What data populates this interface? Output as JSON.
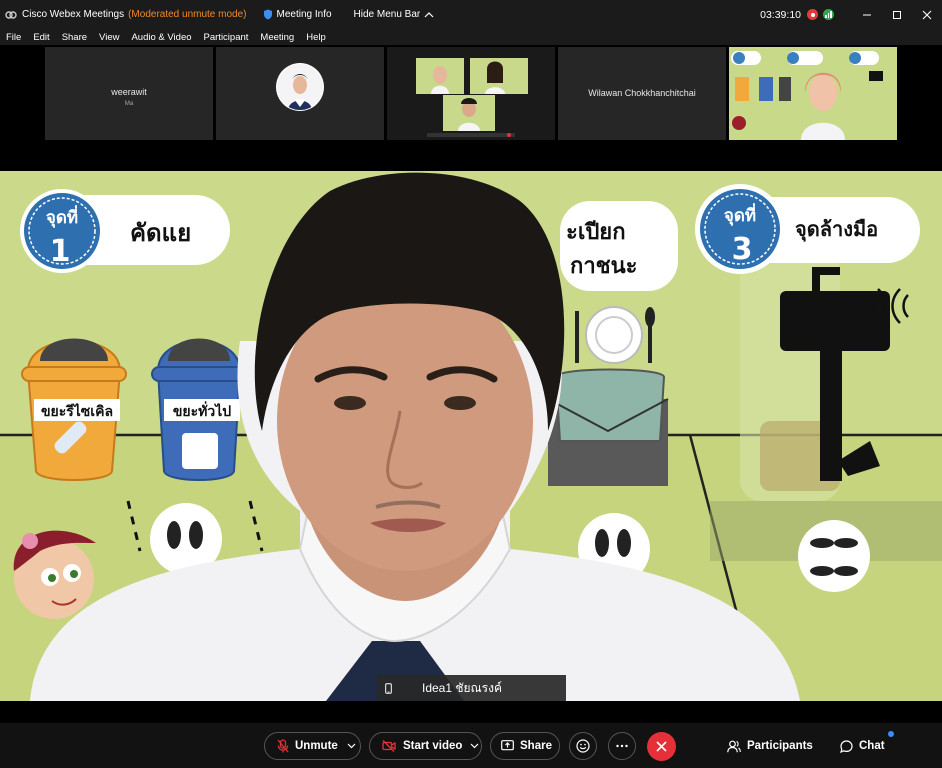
{
  "window": {
    "title": "Cisco Webex Meetings",
    "mode": "(Moderated unmute mode)",
    "meeting_info": "Meeting Info",
    "hide_menu_bar": "Hide Menu Bar",
    "time": "03:39:10"
  },
  "menu": [
    "File",
    "Edit",
    "Share",
    "View",
    "Audio & Video",
    "Participant",
    "Meeting",
    "Help"
  ],
  "thumbnails": [
    {
      "name": "weerawit",
      "sub": "Ma"
    },
    {
      "name": ""
    },
    {
      "name": ""
    },
    {
      "name": "Wilawan Chokkhanchitchai"
    },
    {
      "name": ""
    }
  ],
  "main_video": {
    "name_label": "Idea1 ชัยณรงค์",
    "background_text": {
      "station1": "จุดที่",
      "station1_num": "1",
      "station1_title": "คัดแย",
      "station2_title_line1": "ะเปียก",
      "station2_title_line2": "กาชนะ",
      "station3": "จุดที่",
      "station3_num": "3",
      "station3_title": "จุดล้างมือ",
      "bin1": "ขยะรีไซเคิล",
      "bin2": "ขยะทั่วไป"
    }
  },
  "toolbar": {
    "unmute": "Unmute",
    "start_video": "Start video",
    "share": "Share",
    "participants": "Participants",
    "chat": "Chat"
  },
  "colors": {
    "background_green": "#cbd98b",
    "mode_orange": "#f08a24",
    "end_red": "#e5303a",
    "bin_orange": "#f2a93b",
    "bin_blue": "#3f6cb8",
    "chat_badge": "#3b8ef2"
  }
}
